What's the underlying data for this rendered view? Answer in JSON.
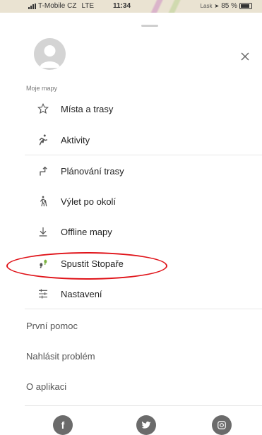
{
  "status_bar": {
    "carrier": "T-Mobile CZ",
    "network": "LTE",
    "time": "11:34",
    "map_label": "Lask",
    "battery": "85 %"
  },
  "section_title": "Moje mapy",
  "menu": [
    {
      "label": "Místa a trasy",
      "icon": "star-outline-icon"
    },
    {
      "label": "Aktivity",
      "icon": "running-person-icon"
    },
    {
      "label": "Plánování trasy",
      "icon": "route-turn-arrow-icon"
    },
    {
      "label": "Výlet po okolí",
      "icon": "hiking-person-icon"
    },
    {
      "label": "Offline mapy",
      "icon": "download-icon"
    },
    {
      "label": "Spustit Stopaře",
      "icon": "footprints-icon"
    },
    {
      "label": "Nastavení",
      "icon": "sliders-icon"
    }
  ],
  "links": {
    "first_aid": "První pomoc",
    "report": "Nahlásit problém",
    "about": "O aplikaci"
  },
  "social": [
    "facebook-icon",
    "twitter-icon",
    "instagram-icon"
  ],
  "colors": {
    "highlight": "#e0141a",
    "icon": "#555555"
  }
}
